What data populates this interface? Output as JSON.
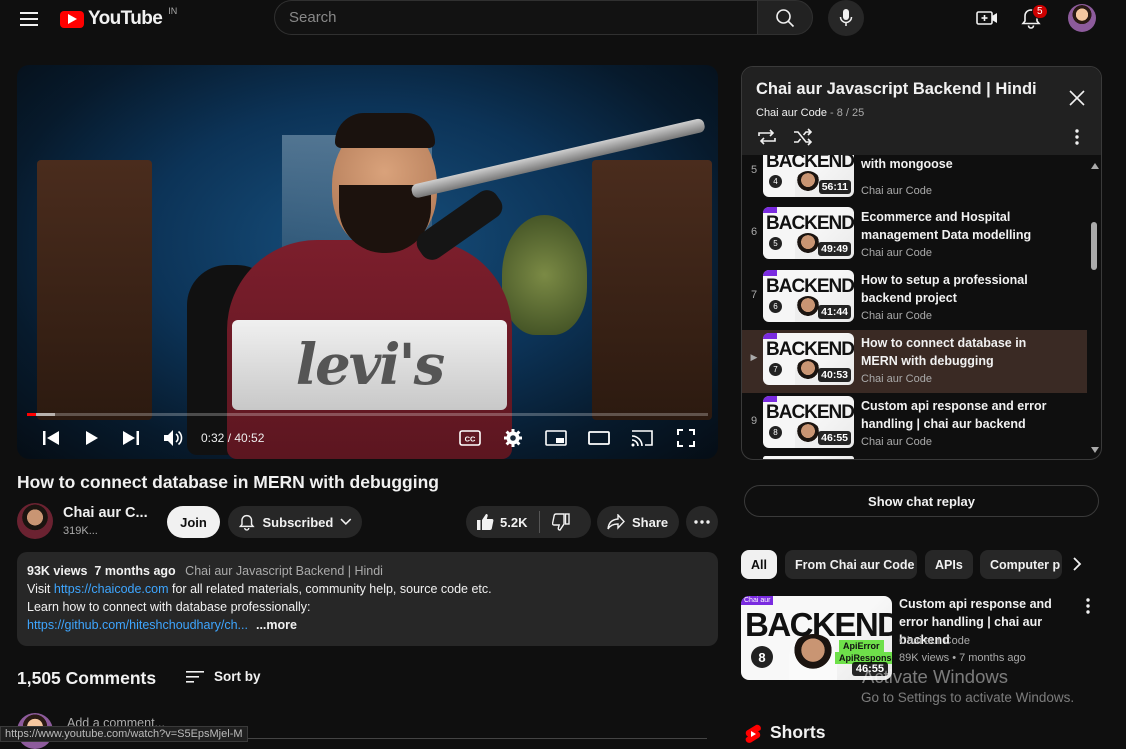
{
  "header": {
    "logo_text": "YouTube",
    "country_code": "IN",
    "search_placeholder": "Search",
    "notification_count": "5"
  },
  "player": {
    "shirt_text": "levi's",
    "current_time": "0:32",
    "duration": "40:52",
    "time_display": "0:32 / 40:52",
    "progress_fraction": 0.013,
    "cc_label": "CC"
  },
  "video": {
    "title": "How to connect database in MERN with debugging",
    "channel_name": "Chai aur C...",
    "subscribers": "319K...",
    "join_label": "Join",
    "subscribed_label": "Subscribed",
    "likes": "5.2K",
    "share_label": "Share"
  },
  "description": {
    "views": "93K views",
    "age": "7 months ago",
    "playlist": "Chai aur Javascript Backend | Hindi",
    "line1_pre": "Visit ",
    "line1_link": "https://chaicode.com",
    "line1_post": " for all related materials, community help, source code etc.",
    "line2": "Learn how to connect with database professionally:",
    "line3_link": "https://github.com/hiteshchoudhary/ch...",
    "more_label": "...more"
  },
  "comments": {
    "count": "1,505 Comments",
    "sort_label": "Sort by",
    "add_placeholder": "Add a comment..."
  },
  "status_bar_url": "https://www.youtube.com/watch?v=S5EpsMjel-M",
  "playlist_panel": {
    "title": "Chai aur Javascript Backend | Hindi",
    "owner": "Chai aur Code",
    "position": "8 / 25",
    "items": [
      {
        "index": "5",
        "title": "with mongoose",
        "channel": "Chai aur Code",
        "duration": "56:11",
        "num": "4",
        "active": false
      },
      {
        "index": "6",
        "title": "Ecommerce and Hospital management Data modelling",
        "channel": "Chai aur Code",
        "duration": "49:49",
        "num": "5",
        "active": false
      },
      {
        "index": "7",
        "title": "How to setup a professional backend project",
        "channel": "Chai aur Code",
        "duration": "41:44",
        "num": "6",
        "active": false
      },
      {
        "index": "▶",
        "title": "How to connect database in MERN with debugging",
        "channel": "Chai aur Code",
        "duration": "40:53",
        "num": "7",
        "active": true
      },
      {
        "index": "9",
        "title": "Custom api response and error handling | chai aur backend",
        "channel": "Chai aur Code",
        "duration": "46:55",
        "num": "8",
        "active": false
      }
    ],
    "thumb_text": "BACKEND"
  },
  "chat_replay_label": "Show chat replay",
  "chips": [
    {
      "label": "All",
      "selected": true
    },
    {
      "label": "From Chai aur Code",
      "selected": false
    },
    {
      "label": "APIs",
      "selected": false
    },
    {
      "label": "Computer p",
      "selected": false
    }
  ],
  "recommendation": {
    "title": "Custom api response and error handling | chai aur backend",
    "channel": "Chai aur Code",
    "meta": "89K views • 7 months ago",
    "duration": "46:55",
    "thumb_text": "BACKEND",
    "thumb_tag": "Chai aur",
    "thumb_num": "8",
    "thumb_badge1": "ApiError",
    "thumb_badge2": "ApiResponse"
  },
  "watermark": {
    "line1": "Activate Windows",
    "line2": "Go to Settings to activate Windows."
  },
  "shorts_label": "Shorts",
  "colors": {
    "background": "#0f0f0f",
    "brand_red": "#ff0000",
    "link_blue": "#3ea6ff",
    "active_row": "#3a2a24"
  }
}
